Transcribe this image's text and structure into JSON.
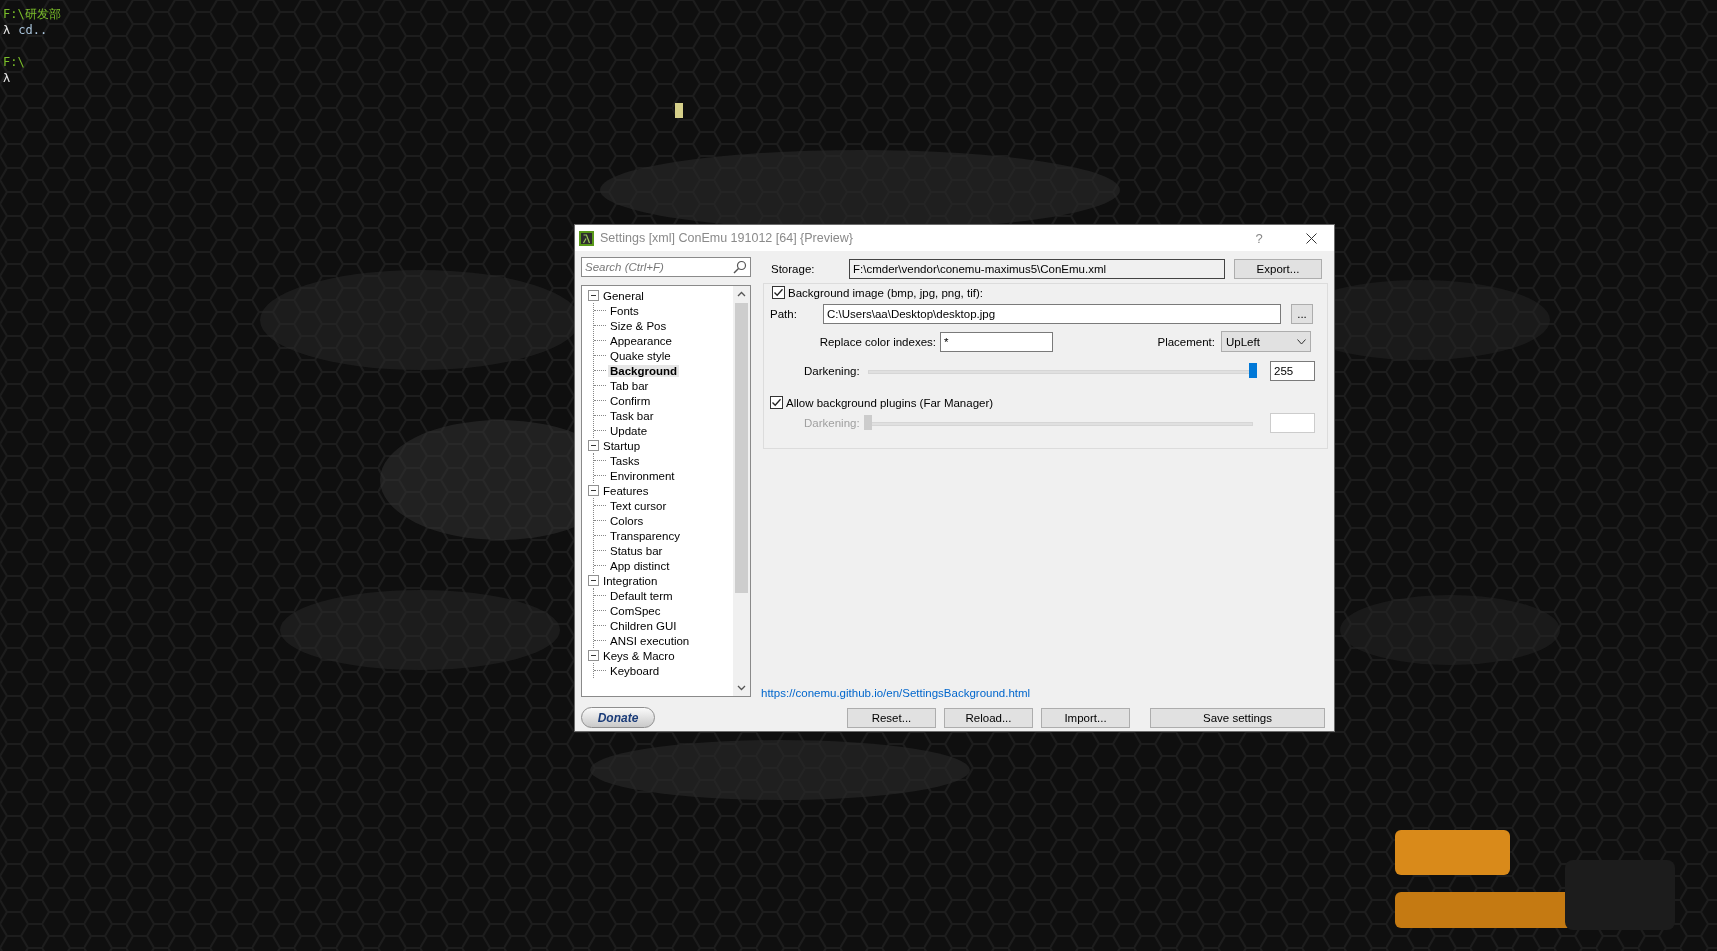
{
  "terminal": {
    "lines": [
      {
        "kind": "path",
        "text": "F:\\研发部"
      },
      {
        "kind": "prompt",
        "prompt": "λ",
        "command": "cd.."
      },
      {
        "kind": "blank"
      },
      {
        "kind": "path",
        "text": "F:\\"
      },
      {
        "kind": "prompt",
        "prompt": "λ"
      }
    ]
  },
  "window": {
    "title": "Settings [xml] ConEmu 191012 [64] {Preview}",
    "help": "?"
  },
  "search": {
    "placeholder": "Search (Ctrl+F)"
  },
  "tree": [
    {
      "label": "General",
      "expanded": true,
      "selected": false,
      "children": [
        {
          "label": "Fonts",
          "selected": false
        },
        {
          "label": "Size & Pos",
          "selected": false
        },
        {
          "label": "Appearance",
          "selected": false
        },
        {
          "label": "Quake style",
          "selected": false
        },
        {
          "label": "Background",
          "selected": true
        },
        {
          "label": "Tab bar",
          "selected": false
        },
        {
          "label": "Confirm",
          "selected": false
        },
        {
          "label": "Task bar",
          "selected": false
        },
        {
          "label": "Update",
          "selected": false
        }
      ]
    },
    {
      "label": "Startup",
      "expanded": true,
      "selected": false,
      "children": [
        {
          "label": "Tasks",
          "selected": false
        },
        {
          "label": "Environment",
          "selected": false
        }
      ]
    },
    {
      "label": "Features",
      "expanded": true,
      "selected": false,
      "children": [
        {
          "label": "Text cursor",
          "selected": false
        },
        {
          "label": "Colors",
          "selected": false
        },
        {
          "label": "Transparency",
          "selected": false
        },
        {
          "label": "Status bar",
          "selected": false
        },
        {
          "label": "App distinct",
          "selected": false
        }
      ]
    },
    {
      "label": "Integration",
      "expanded": true,
      "selected": false,
      "children": [
        {
          "label": "Default term",
          "selected": false
        },
        {
          "label": "ComSpec",
          "selected": false
        },
        {
          "label": "Children GUI",
          "selected": false
        },
        {
          "label": "ANSI execution",
          "selected": false
        }
      ]
    },
    {
      "label": "Keys & Macro",
      "expanded": true,
      "selected": false,
      "children": [
        {
          "label": "Keyboard",
          "selected": false
        }
      ]
    }
  ],
  "donate": "Donate",
  "storage": {
    "label": "Storage:",
    "value": "F:\\cmder\\vendor\\conemu-maximus5\\ConEmu.xml",
    "button": "Export..."
  },
  "background": {
    "label": "Background image (bmp, jpg, png, tif):",
    "checked": true,
    "path": {
      "label": "Path:",
      "value": "C:\\Users\\aa\\Desktop\\desktop.jpg",
      "button": "..."
    },
    "replace": {
      "label": "Replace color indexes:",
      "value": "*"
    },
    "placement": {
      "label": "Placement:",
      "value": "UpLeft"
    },
    "darkening": {
      "label": "Darkening:",
      "level": 1,
      "value": "255"
    }
  },
  "plugins": {
    "label": "Allow background plugins (Far Manager)",
    "checked": true,
    "darkening": {
      "label": "Darkening:",
      "level": 0,
      "disabled": true
    }
  },
  "link": "https://conemu.github.io/en/SettingsBackground.html",
  "buttons": [
    "Reset...",
    "Reload...",
    "Import...",
    "Save settings"
  ]
}
